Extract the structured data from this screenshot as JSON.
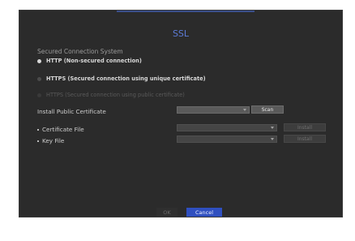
{
  "dialog": {
    "title": "SSL"
  },
  "secured_connection": {
    "label": "Secured Connection System",
    "options": [
      {
        "label": "HTTP (Non-secured connection)",
        "state": "selected"
      },
      {
        "label": "HTTPS (Secured connection using unique certificate)",
        "state": "unselected"
      },
      {
        "label": "HTTPS (Secured connection using public certificate)",
        "state": "disabled"
      }
    ]
  },
  "install_public_certificate": {
    "label": "Install Public Certificate",
    "select_value": "",
    "scan_label": "Scan"
  },
  "certificate_file": {
    "label": "Certificate File",
    "select_value": "",
    "install_label": "Install"
  },
  "key_file": {
    "label": "Key File",
    "select_value": "",
    "install_label": "Install"
  },
  "footer": {
    "ok_label": "OK",
    "cancel_label": "Cancel"
  },
  "colors": {
    "accent": "#2f4fbf",
    "title": "#5c7bd6",
    "panel": "#2b2b2b"
  }
}
